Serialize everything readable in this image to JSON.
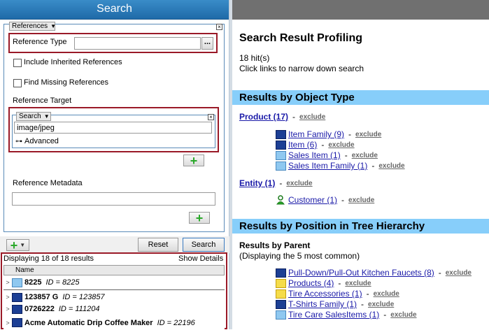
{
  "left": {
    "title": "Search",
    "references_dropdown": "References",
    "reference_type_label": "Reference Type",
    "reference_type_value": "",
    "browse_label": "...",
    "include_inherited_label": "Include Inherited References",
    "find_missing_label": "Find Missing References",
    "reference_target_label": "Reference Target",
    "search_dropdown": "Search",
    "search_value": "image/jpeg",
    "advanced_label": "Advanced",
    "reference_metadata_label": "Reference Metadata",
    "reference_metadata_value": "",
    "reset_label": "Reset",
    "search_label": "Search",
    "displaying_text": "Displaying 18 of 18 results",
    "show_details_label": "Show Details",
    "name_column": "Name",
    "results": [
      {
        "name": "8225",
        "id": "ID = 8225"
      },
      {
        "name": "123857 G",
        "id": "ID = 123857"
      },
      {
        "name": "0726222",
        "id": "ID = 111204"
      },
      {
        "name": "Acme Automatic Drip Coffee Maker",
        "id": "ID = 22196"
      }
    ]
  },
  "right": {
    "title": "Search Result Profiling",
    "hits": "18 hit(s)",
    "instructions": "Click links to narrow down search",
    "section_object_type": "Results by Object Type",
    "product_link": "Product (17)",
    "entity_link": "Entity (1)",
    "exclude_label": "exclude",
    "product_children": [
      {
        "label": "Item Family (9)",
        "icon": "item-family-icon"
      },
      {
        "label": "Item (6)",
        "icon": "item-icon"
      },
      {
        "label": "Sales Item (1)",
        "icon": "sales-item-icon"
      },
      {
        "label": "Sales Item Family (1)",
        "icon": "sales-item-family-icon"
      }
    ],
    "entity_children": [
      {
        "label": "Customer (1)",
        "icon": "customer-icon"
      }
    ],
    "section_tree": "Results by Position in Tree Hierarchy",
    "results_by_parent": "Results by Parent",
    "displaying_common": "(Displaying the 5 most common)",
    "parents": [
      {
        "label": "Pull-Down/Pull-Out Kitchen Faucets (8)",
        "icon": "item-family-icon"
      },
      {
        "label": "Products (4)",
        "icon": "folder-icon"
      },
      {
        "label": "Tire Accessories (1)",
        "icon": "folder-icon"
      },
      {
        "label": "T-Shirts Family (1)",
        "icon": "item-family-icon"
      },
      {
        "label": "Tire Care SalesItems (1)",
        "icon": "sales-item-family-icon"
      }
    ]
  }
}
